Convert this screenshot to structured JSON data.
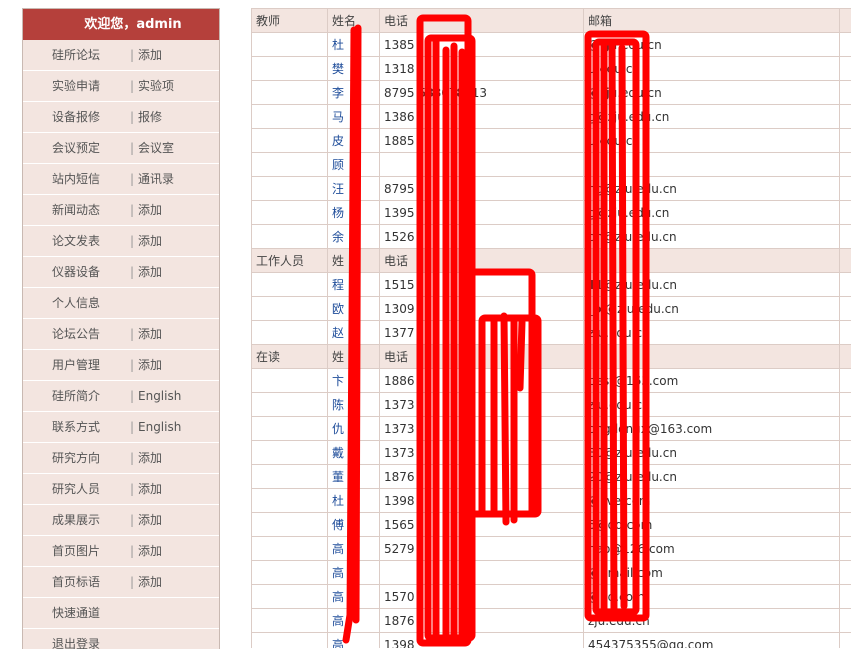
{
  "sidebar": {
    "welcome": "欢迎您，admin",
    "items": [
      {
        "main": "硅所论坛",
        "sub": "添加"
      },
      {
        "main": "实验申请",
        "sub": "实验项"
      },
      {
        "main": "设备报修",
        "sub": "报修"
      },
      {
        "main": "会议预定",
        "sub": "会议室"
      },
      {
        "main": "站内短信",
        "sub": "通讯录"
      },
      {
        "main": "新闻动态",
        "sub": "添加"
      },
      {
        "main": "论文发表",
        "sub": "添加"
      },
      {
        "main": "仪器设备",
        "sub": "添加"
      },
      {
        "main": "个人信息",
        "sub": ""
      },
      {
        "main": "论坛公告",
        "sub": "添加"
      },
      {
        "main": "用户管理",
        "sub": "添加"
      },
      {
        "main": "硅所简介",
        "sub": "English"
      },
      {
        "main": "联系方式",
        "sub": "English"
      },
      {
        "main": "研究方向",
        "sub": "添加"
      },
      {
        "main": "研究人员",
        "sub": "添加"
      },
      {
        "main": "成果展示",
        "sub": "添加"
      },
      {
        "main": "首页图片",
        "sub": "添加"
      },
      {
        "main": "首页标语",
        "sub": "添加"
      },
      {
        "main": "快速通道",
        "sub": ""
      },
      {
        "main": "退出登录",
        "sub": ""
      }
    ]
  },
  "table": {
    "rows": [
      {
        "type": "header",
        "group": "教师",
        "name": "姓名",
        "phone": "电话",
        "email": "邮箱"
      },
      {
        "type": "data",
        "name": "杜",
        "phone": "1385",
        "email": "@zju.edu.cn"
      },
      {
        "type": "data",
        "name": "樊",
        "phone": "1318",
        "email": "u.edu.cn"
      },
      {
        "type": "data",
        "name": "李",
        "phone": "8795           588078313",
        "email": "@zju.edu.cn"
      },
      {
        "type": "data",
        "name": "马",
        "phone": "1386",
        "email": "g@zju.edu.cn"
      },
      {
        "type": "data",
        "name": "皮",
        "phone": "1885",
        "email": "u.edu.cn"
      },
      {
        "type": "data",
        "name": "顾",
        "phone": "",
        "email": ""
      },
      {
        "type": "data",
        "name": "汪",
        "phone": "8795",
        "email": "ng@zju.edu.cn"
      },
      {
        "type": "data",
        "name": "杨",
        "phone": "1395",
        "email": "g@zju.edu.cn"
      },
      {
        "type": "data",
        "name": "余",
        "phone": "1526",
        "email": "on@zju.edu.cn"
      },
      {
        "type": "header",
        "group": "工作人员",
        "name": "姓",
        "phone": "电话",
        "email": ""
      },
      {
        "type": "data",
        "name": "程",
        "phone": "1515",
        "email": "11@zju.edu.cn"
      },
      {
        "type": "data",
        "name": "欧",
        "phone": "1309",
        "email": "_o @zju.edu.cn"
      },
      {
        "type": "data",
        "name": "赵",
        "phone": "1377",
        "email": "zju.edu.cn"
      },
      {
        "type": "header",
        "group": "在读",
        "name": "姓",
        "phone": "电话",
        "email": ""
      },
      {
        "type": "data",
        "name": "卞",
        "phone": "1886",
        "email": "best@163.com"
      },
      {
        "type": "data",
        "name": "陈",
        "phone": "1373",
        "email": "zju.edu.cn"
      },
      {
        "type": "data",
        "name": "仇",
        "phone": "1373",
        "email": "ongdongx@163.com"
      },
      {
        "type": "data",
        "name": "戴",
        "phone": "1373",
        "email": "80@zju.edu.cn"
      },
      {
        "type": "data",
        "name": "董",
        "phone": "1876",
        "email": "20@zju.edu.cn"
      },
      {
        "type": "data",
        "name": "杜",
        "phone": "1398",
        "email": "@live.com"
      },
      {
        "type": "data",
        "name": "傅",
        "phone": "1565",
        "email": "5@qq.com"
      },
      {
        "type": "data",
        "name": "高",
        "phone": "5279",
        "email": "hao@126.com"
      },
      {
        "type": "data",
        "name": "高",
        "phone": "",
        "email": "@gmail.com"
      },
      {
        "type": "data",
        "name": "高",
        "phone": "1570",
        "email": "@qq.com"
      },
      {
        "type": "data",
        "name": "高",
        "phone": "1876",
        "email": "zju.edu.cn"
      },
      {
        "type": "data",
        "name": "高",
        "phone": "1398",
        "email": "454375355@qq.com"
      }
    ]
  },
  "colors": {
    "header_red": "#b5403b",
    "sidebar_bg": "#f3e5e0",
    "redaction": "#ff0000"
  }
}
